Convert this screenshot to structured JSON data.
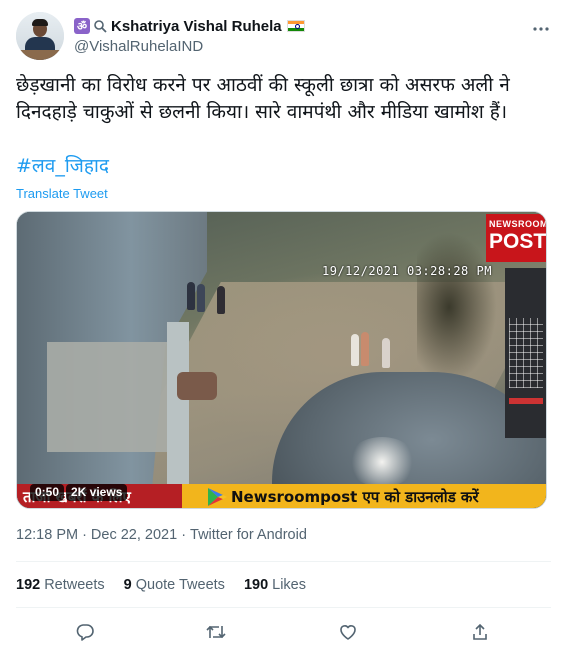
{
  "author": {
    "display_name": "Kshatriya Vishal Ruhela",
    "handle": "@VishalRuhelaIND",
    "badges": [
      "om-emoji",
      "search-emoji",
      "india-flag-emoji"
    ]
  },
  "tweet": {
    "text": "छेड़खानी का विरोध करने पर आठवीं की स्कूली छात्रा को असरफ अली ने दिनदहाड़े चाकुओं से छलनी किया। सारे वामपंथी और मीडिया खामोश हैं।",
    "hashtag": "#लव_जिहाद",
    "translate_label": "Translate Tweet"
  },
  "video": {
    "duration": "0:50",
    "views": "2K views",
    "cctv_timestamp": "19/12/2021  03:28:28 PM",
    "logo_top": "NEWSROOM",
    "logo_main": "POST",
    "ticker_left": "ताजा खबरों के लिए",
    "ticker_right": "Newsroompost एप को डाउनलोड करें"
  },
  "meta": {
    "time": "12:18 PM",
    "date": "Dec 22, 2021",
    "separator": "·",
    "source": "Twitter for Android"
  },
  "stats": {
    "retweets_count": "192",
    "retweets_label": "Retweets",
    "quotes_count": "9",
    "quotes_label": "Quote Tweets",
    "likes_count": "190",
    "likes_label": "Likes"
  },
  "actions": [
    "reply-icon",
    "retweet-icon",
    "like-icon",
    "share-icon"
  ],
  "colors": {
    "accent": "#1d9bf0",
    "text_primary": "#0f1419",
    "text_secondary": "#536471",
    "divider": "#eff3f4"
  }
}
